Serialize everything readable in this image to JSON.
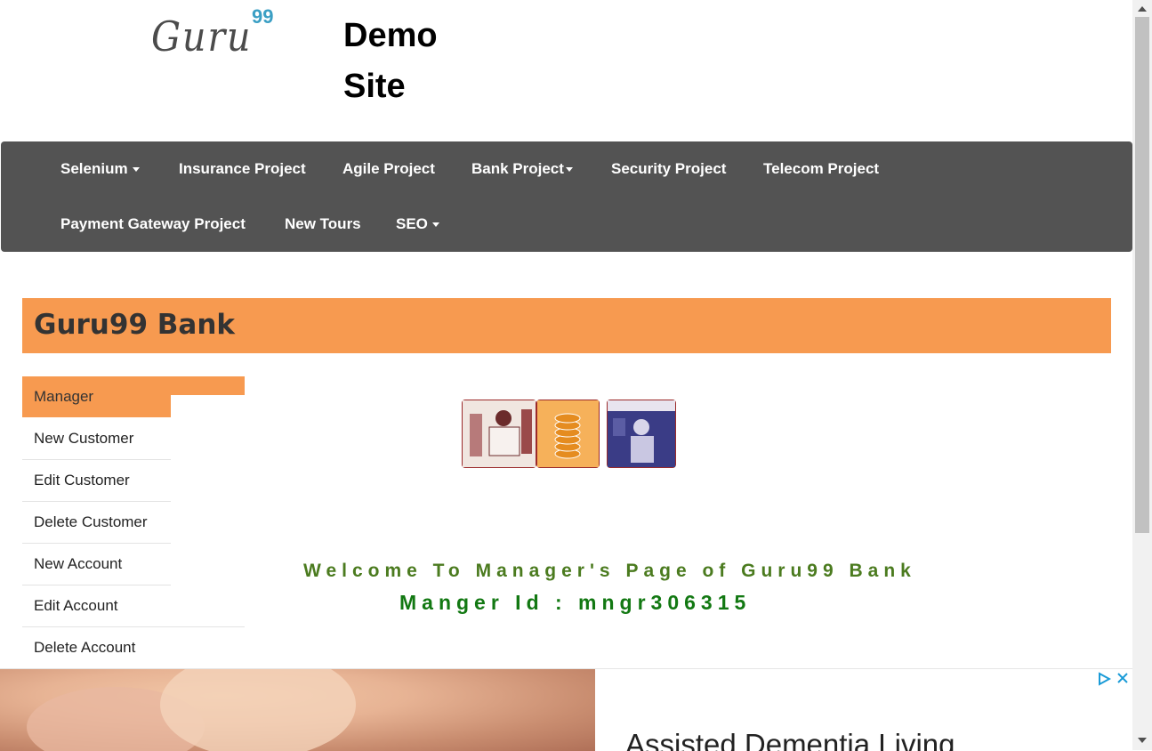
{
  "header": {
    "logo_text": "Guru",
    "logo_superscript": "99",
    "site_title_line1": "Demo",
    "site_title_line2": "Site"
  },
  "nav": {
    "row1": [
      {
        "label": "Selenium",
        "dropdown": true
      },
      {
        "label": "Insurance Project",
        "dropdown": false
      },
      {
        "label": "Agile Project",
        "dropdown": false
      },
      {
        "label": "Bank Project",
        "dropdown": true
      },
      {
        "label": "Security Project",
        "dropdown": false
      },
      {
        "label": "Telecom Project",
        "dropdown": false
      }
    ],
    "row2": [
      {
        "label": "Payment Gateway Project",
        "dropdown": false
      },
      {
        "label": "New Tours",
        "dropdown": false
      },
      {
        "label": "SEO",
        "dropdown": true
      }
    ]
  },
  "bank": {
    "title": "Guru99 Bank"
  },
  "sidebar": {
    "items": [
      {
        "label": "Manager",
        "active": true
      },
      {
        "label": "New Customer"
      },
      {
        "label": "Edit Customer"
      },
      {
        "label": "Delete Customer"
      },
      {
        "label": "New Account"
      },
      {
        "label": "Edit Account"
      },
      {
        "label": "Delete Account"
      }
    ]
  },
  "main": {
    "welcome_text": "Welcome To Manager's Page of Guru99 Bank",
    "manager_id_text": "Manger Id : mngr306315"
  },
  "ad": {
    "headline": "Assisted Dementia Living"
  },
  "colors": {
    "nav_bg": "#535353",
    "accent_orange": "#f79a50",
    "welcome_green": "#4b7b1f",
    "manager_id_green": "#127812"
  }
}
